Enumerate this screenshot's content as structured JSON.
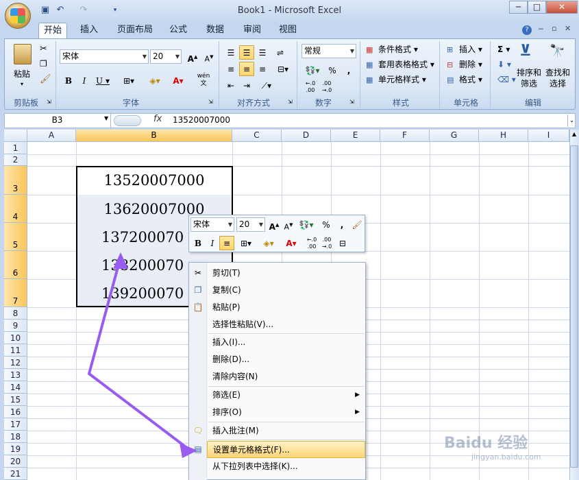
{
  "window": {
    "title": "Book1 - Microsoft Excel"
  },
  "ribbon_tabs": [
    "开始",
    "插入",
    "页面布局",
    "公式",
    "数据",
    "审阅",
    "视图"
  ],
  "clipboard": {
    "paste": "粘贴",
    "group": "剪贴板"
  },
  "font": {
    "name": "宋体",
    "size": "20",
    "group": "字体",
    "wen": "wén\n文"
  },
  "alignment": {
    "group": "对齐方式"
  },
  "number": {
    "format": "常规",
    "group": "数字",
    "percent": "%",
    "comma": ","
  },
  "styles": {
    "conditional": "条件格式",
    "table": "套用表格格式",
    "cell_styles": "单元格样式",
    "group": "样式"
  },
  "cells": {
    "insert": "插入",
    "delete": "删除",
    "format": "格式",
    "group": "单元格"
  },
  "editing": {
    "sort": "排序和\n筛选",
    "find": "查找和\n选择",
    "group": "编辑",
    "sigma": "Σ"
  },
  "formula_bar": {
    "name_box": "B3",
    "fx": "fx",
    "value": "13520007000"
  },
  "columns": [
    "A",
    "B",
    "C",
    "D",
    "E",
    "F",
    "G",
    "H",
    "I"
  ],
  "rows": [
    "1",
    "2",
    "3",
    "4",
    "5",
    "6",
    "7",
    "8",
    "9",
    "10",
    "11",
    "12",
    "13",
    "14",
    "15",
    "16",
    "17",
    "18",
    "19",
    "20",
    "21"
  ],
  "cell_values": [
    "13520007000",
    "13620007000",
    "137200070",
    "138200070",
    "139200070"
  ],
  "mini_toolbar": {
    "font": "宋体",
    "size": "20"
  },
  "context_menu": [
    {
      "label": "剪切(T)",
      "icon": "cut-icon"
    },
    {
      "label": "复制(C)",
      "icon": "copy-icon"
    },
    {
      "label": "粘贴(P)",
      "icon": "paste-icon"
    },
    {
      "label": "选择性粘贴(V)...",
      "icon": ""
    },
    {
      "label": "插入(I)...",
      "icon": ""
    },
    {
      "label": "删除(D)...",
      "icon": ""
    },
    {
      "label": "清除内容(N)",
      "icon": ""
    },
    {
      "label": "筛选(E)",
      "icon": "",
      "submenu": true
    },
    {
      "label": "排序(O)",
      "icon": "",
      "submenu": true
    },
    {
      "label": "插入批注(M)",
      "icon": "comment-icon"
    },
    {
      "label": "设置单元格格式(F)...",
      "icon": "format-cells-icon",
      "highlighted": true
    },
    {
      "label": "从下拉列表中选择(K)...",
      "icon": ""
    }
  ],
  "watermark": {
    "logo": "Baidu 经验",
    "url": "jingyan.baidu.com"
  }
}
